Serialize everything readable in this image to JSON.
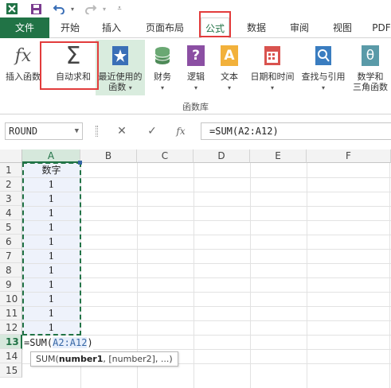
{
  "quick_access": {
    "icons": [
      "excel-logo-icon",
      "save-icon",
      "undo-icon",
      "redo-icon",
      "customize-icon"
    ]
  },
  "tabs": [
    {
      "label": "文件",
      "active": false
    },
    {
      "label": "开始",
      "active": false
    },
    {
      "label": "插入",
      "active": false
    },
    {
      "label": "页面布局",
      "active": false
    },
    {
      "label": "公式",
      "active": true
    },
    {
      "label": "数据",
      "active": false
    },
    {
      "label": "审阅",
      "active": false
    },
    {
      "label": "视图",
      "active": false
    },
    {
      "label": "PDF",
      "active": false
    }
  ],
  "ribbon": {
    "insert_function": "插入函数",
    "autosum": "自动求和",
    "recent_line1": "最近使用的",
    "recent_line2": "函数",
    "financial": "财务",
    "logical": "逻辑",
    "text": "文本",
    "datetime": "日期和时间",
    "lookup": "查找与引用",
    "math_line1": "数学和",
    "math_line2": "三角函数",
    "group_label": "函数库",
    "fx_glyph": "fx",
    "sigma_glyph": "Σ",
    "logical_glyph": "?",
    "text_glyph": "A",
    "math_glyph": "θ"
  },
  "formula_bar": {
    "name_box": "ROUND",
    "cancel_glyph": "✕",
    "enter_glyph": "✓",
    "fx_glyph": "fx",
    "formula": "=SUM(A2:A12)"
  },
  "grid": {
    "columns": [
      "A",
      "B",
      "C",
      "D",
      "E",
      "F"
    ],
    "rows": [
      "1",
      "2",
      "3",
      "4",
      "5",
      "6",
      "7",
      "8",
      "9",
      "10",
      "11",
      "12",
      "13",
      "14",
      "15"
    ],
    "cells_A": [
      "数字",
      "1",
      "1",
      "1",
      "1",
      "1",
      "1",
      "1",
      "1",
      "1",
      "1",
      "1"
    ],
    "active_cell_prefix": "=SUM(",
    "active_cell_ref": "A2:A12",
    "active_cell_suffix": ")",
    "tooltip_func": "SUM(",
    "tooltip_arg1": "number1",
    "tooltip_rest": ", [number2], ...)"
  },
  "colors": {
    "accent": "#217346",
    "highlight_box": "#e23c3c",
    "reference": "#3465a4"
  }
}
